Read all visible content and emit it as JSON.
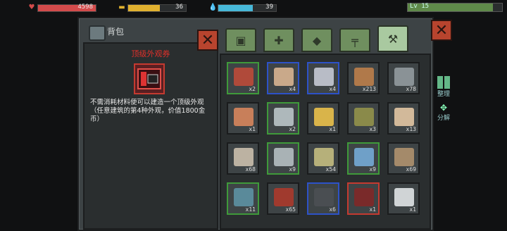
{
  "status": {
    "hp": {
      "value": "4598",
      "fill": 1.0,
      "color": "#d34b4b",
      "icon": "heart-icon"
    },
    "food": {
      "value": "36",
      "fill": 0.55,
      "color": "#e0b12f",
      "icon": "food-icon"
    },
    "water": {
      "value": "39",
      "fill": 0.6,
      "color": "#47b8d8",
      "icon": "water-icon"
    },
    "level": {
      "value": "Lv 15",
      "fill": 0.9,
      "color": "#5f8a4a"
    }
  },
  "window": {
    "title": "背包",
    "close_icon": "close-icon",
    "tabs": [
      {
        "icon": "backpack-icon",
        "active": false
      },
      {
        "icon": "medkit-icon",
        "active": false
      },
      {
        "icon": "food-bag-icon",
        "active": false
      },
      {
        "icon": "gun-icon",
        "active": false
      },
      {
        "icon": "materials-icon",
        "active": true
      }
    ]
  },
  "detail": {
    "name": "顶级外观券",
    "description": "不需消耗材料便可以建造一个顶级外观（任意建筑的第4种外观，价值1800金币）",
    "icon": "premium-coupon-icon"
  },
  "inventory": [
    {
      "icon": "dynamite-icon",
      "count": "x2",
      "border": "green",
      "color": "#b04a3a"
    },
    {
      "icon": "cement-bag-icon",
      "count": "x4",
      "border": "blue",
      "color": "#c9a98a"
    },
    {
      "icon": "cement-bag-icon",
      "count": "x4",
      "border": "blue",
      "color": "#b8bcc6"
    },
    {
      "icon": "wood-planks-icon",
      "count": "x213",
      "border": "none",
      "color": "#b0794a"
    },
    {
      "icon": "stone-icon",
      "count": "x78",
      "border": "none",
      "color": "#8a9296"
    },
    {
      "icon": "copper-ingot-icon",
      "count": "x1",
      "border": "none",
      "color": "#c87f5a"
    },
    {
      "icon": "iron-ingot-icon",
      "count": "x2",
      "border": "green",
      "color": "#aeb8bb"
    },
    {
      "icon": "sulfur-bag-icon",
      "count": "x1",
      "border": "none",
      "color": "#d9b44a"
    },
    {
      "icon": "fuel-can-icon",
      "count": "x3",
      "border": "none",
      "color": "#8a8a4a"
    },
    {
      "icon": "board-icon",
      "count": "x13",
      "border": "none",
      "color": "#d2b99a"
    },
    {
      "icon": "nut-icon",
      "count": "x68",
      "border": "none",
      "color": "#bcb2a2"
    },
    {
      "icon": "bolt-icon",
      "count": "x9",
      "border": "green",
      "color": "#a9b2b5"
    },
    {
      "icon": "cloth-icon",
      "count": "x54",
      "border": "none",
      "color": "#b6b07a"
    },
    {
      "icon": "fabric-icon",
      "count": "x9",
      "border": "green",
      "color": "#6fa0c8"
    },
    {
      "icon": "rope-icon",
      "count": "x69",
      "border": "none",
      "color": "#a48a6a"
    },
    {
      "icon": "cable-icon",
      "count": "x11",
      "border": "green",
      "color": "#5a8a9a"
    },
    {
      "icon": "wire-icon",
      "count": "x65",
      "border": "none",
      "color": "#a03a2e"
    },
    {
      "icon": "chip-icon",
      "count": "x6",
      "border": "blue",
      "color": "#4a4e52"
    },
    {
      "icon": "premium-coupon-icon",
      "count": "x1",
      "border": "red",
      "color": "#7a2a2a"
    },
    {
      "icon": "lighter-icon",
      "count": "x1",
      "border": "none",
      "color": "#d0d4d6"
    }
  ],
  "side": {
    "sort_label": "整理",
    "dismantle_label": "分解"
  }
}
